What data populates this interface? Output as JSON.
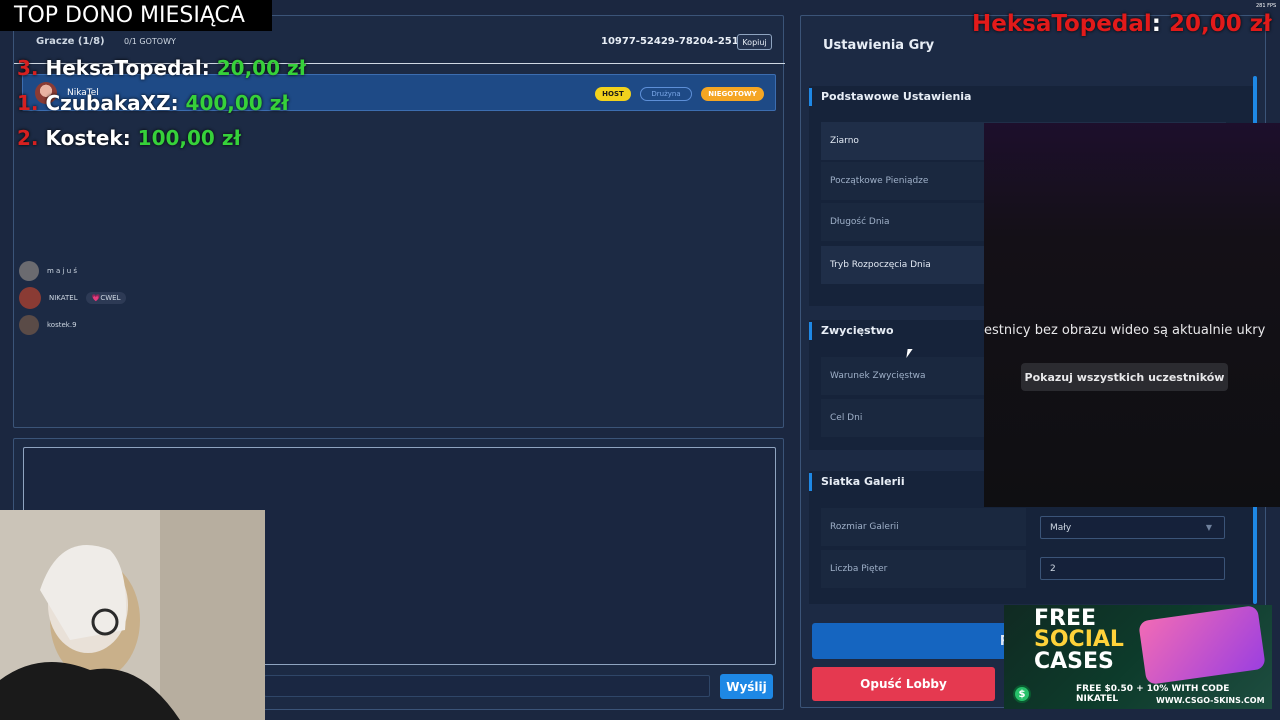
{
  "lobby": {
    "players_title": "Gracze (1/8)",
    "ready_count": "0/1 GOTOWY",
    "lobby_code": "10977-52429-78204-251",
    "copy_label": "Kopiuj",
    "player": {
      "name": "NikaTel",
      "host_badge": "HOST",
      "team_badge": "Drużyna",
      "status_badge": "NIEGOTOWY"
    }
  },
  "viewers": [
    {
      "name": "m a j u ś",
      "avatar_color": "#6b6b70"
    },
    {
      "name": "NIKATEL",
      "tag": "💗CWEL",
      "avatar_color": "#8a3b34"
    },
    {
      "name": "kostek.9",
      "avatar_color": "#5a4b47"
    }
  ],
  "chat": {
    "send_label": "Wyślij"
  },
  "settings": {
    "title": "Ustawienia Gry",
    "basic": {
      "title": "Podstawowe Ustawienia",
      "rows": [
        "Ziarno",
        "Początkowe Pieniądze",
        "Długość Dnia",
        "Tryb Rozpoczęcia Dnia"
      ]
    },
    "victory": {
      "title": "Zwycięstwo",
      "rows": [
        "Warunek Zwycięstwa",
        "Cel Dni"
      ]
    },
    "gallery": {
      "title": "Siatka Galerii",
      "size_label": "Rozmiar Galerii",
      "size_value": "Mały",
      "floors_label": "Liczba Pięter",
      "floors_value": "2"
    },
    "start_label": "Rozpoczn",
    "leave_label": "Opuść Lobby"
  },
  "overlay": {
    "top_dono_title": "TOP DONO MIESIĄCA",
    "donors": [
      {
        "rank": "3.",
        "name": "HeksaTopedal:",
        "amount": "20,00 zł"
      },
      {
        "rank": "1.",
        "name": "CzubakaXZ:",
        "amount": "400,00 zł"
      },
      {
        "rank": "2.",
        "name": "Kostek:",
        "amount": "100,00 zł"
      }
    ],
    "latest_donor_name": "HeksaTopedal",
    "latest_donor_sep": ":",
    "latest_donor_amount": "20,00 zł",
    "video_message": "estnicy bez obrazu wideo są aktualnie ukry",
    "video_button": "Pokazuj wszystkich uczestników",
    "fps": "281 FPS"
  },
  "ad": {
    "line_free": "FREE",
    "line_social": "SOCIAL",
    "line_cases": "CASES",
    "promo": "FREE $0.50 + 10% WITH CODE NIKATEL",
    "site": "WWW.CSGO-SKINS.COM",
    "coin_symbol": "$"
  }
}
